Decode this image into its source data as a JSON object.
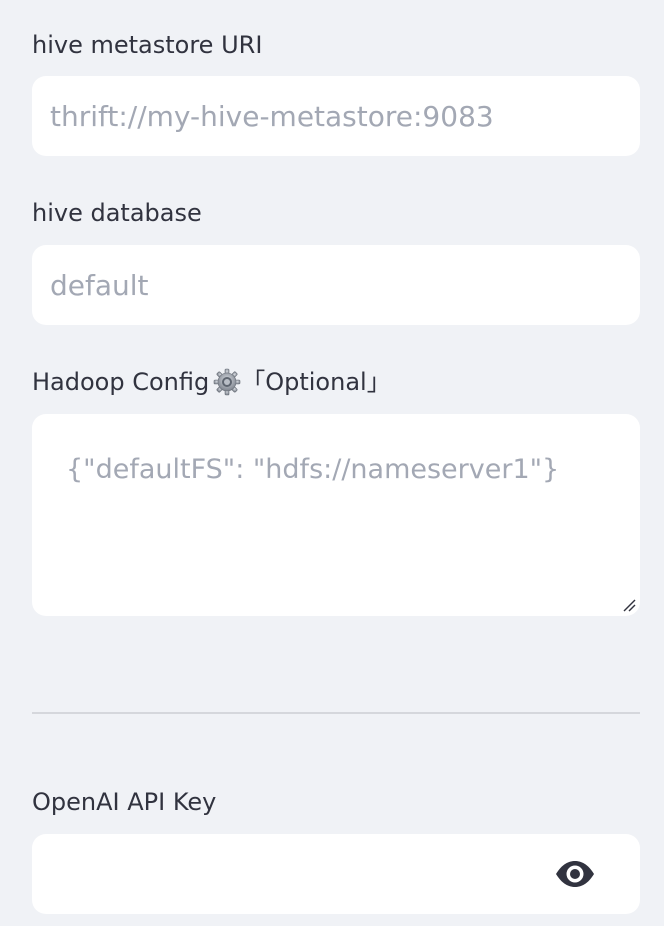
{
  "hive_uri": {
    "label": "hive metastore URI",
    "value": "",
    "placeholder": "thrift://my-hive-metastore:9083"
  },
  "hive_database": {
    "label": "hive database",
    "value": "",
    "placeholder": "default"
  },
  "hadoop_config": {
    "label": "Hadoop Config",
    "optional_tag": "「Optional」",
    "value": "",
    "placeholder": "{\"defaultFS\": \"hdfs://nameserver1\"}",
    "icon": "gear-icon"
  },
  "openai": {
    "label": "OpenAI API Key",
    "value": "",
    "placeholder": "",
    "toggle_icon": "eye-icon"
  },
  "colors": {
    "background": "#f0f2f6",
    "field_background": "#ffffff",
    "text": "#31333f",
    "placeholder": "#a3a8b4",
    "divider": "#d5d7dc"
  }
}
